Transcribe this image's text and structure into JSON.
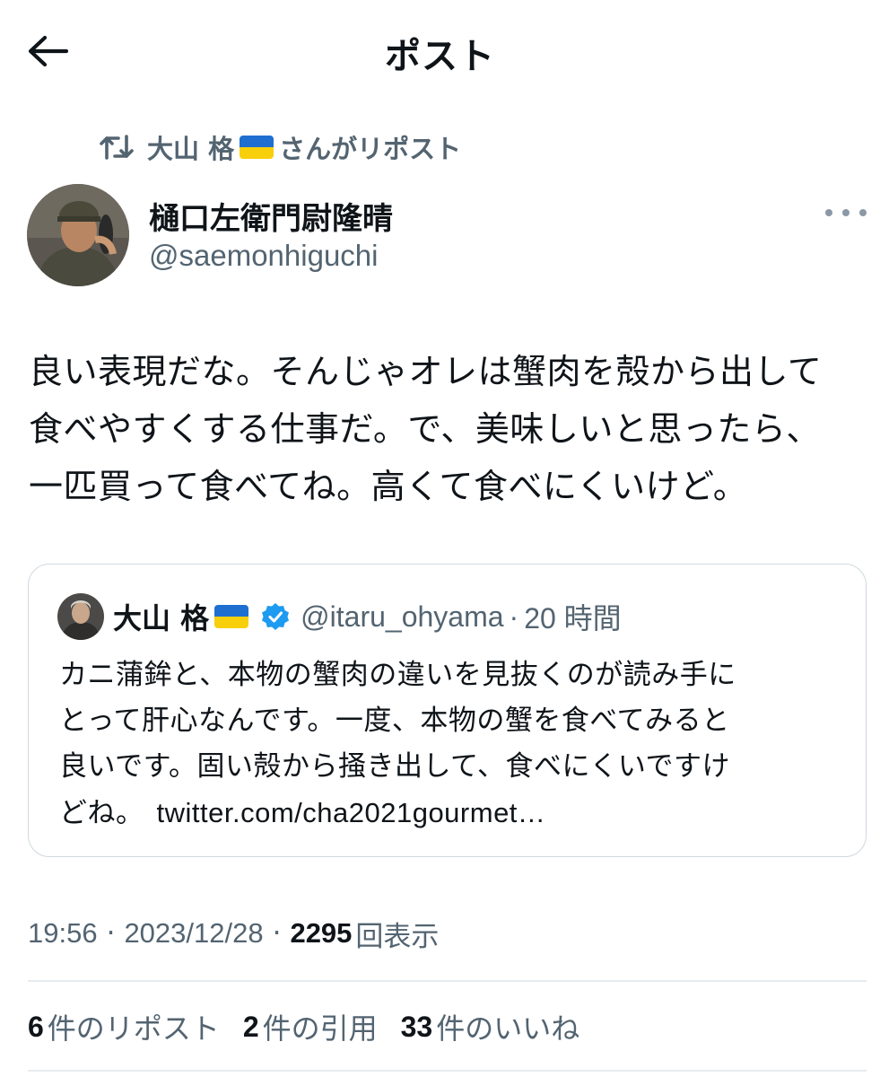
{
  "header": {
    "title": "ポスト",
    "back_icon": "arrow-left-icon"
  },
  "repost": {
    "icon": "repost-icon",
    "reposter_name": "大山 格",
    "suffix": "さんがリポスト"
  },
  "tweet": {
    "author": {
      "name": "樋口左衛門尉隆晴",
      "handle": "@saemonhiguchi"
    },
    "more_icon": "more-horizontal-icon",
    "text_lines": [
      "良い表現だな。そんじゃオレは蟹肉を殻から出して",
      "食べやすくする仕事だ。で、美味しいと思ったら、",
      "一匹買って食べてね。高くて食べにくいけど。"
    ]
  },
  "quote": {
    "name": "大山 格",
    "verified_icon": "verified-badge-icon",
    "handle": "@itaru_ohyama",
    "separator": "·",
    "time": "20 時間",
    "text_lines": [
      "カニ蒲鉾と、本物の蟹肉の違いを見抜くのが読み手に",
      "とって肝心なんです。一度、本物の蟹を食べてみると",
      "良いです。固い殻から掻き出して、食べにくいですけ"
    ],
    "last_line_text": "どね。",
    "link": "twitter.com/cha2021gourmet…"
  },
  "meta": {
    "time": "19:56",
    "sep": "·",
    "date": "2023/12/28",
    "views_count": "2295",
    "views_label": "回表示"
  },
  "stats": [
    {
      "count": "6",
      "label": "件のリポスト"
    },
    {
      "count": "2",
      "label": "件の引用"
    },
    {
      "count": "33",
      "label": "件のいいね"
    }
  ],
  "colors": {
    "text": "#0f1419",
    "secondary": "#536471",
    "border": "#cfd9de",
    "verified": "#1d9bf0",
    "flag_blue": "#1f6fd1",
    "flag_yellow": "#f7cf0a"
  }
}
